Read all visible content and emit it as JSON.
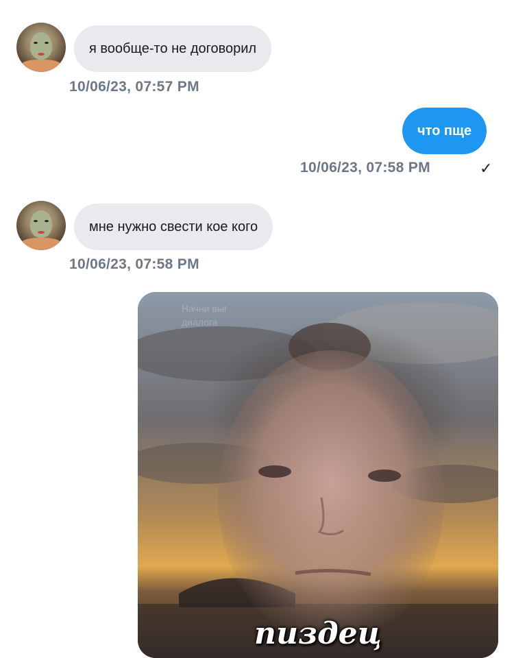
{
  "messages": [
    {
      "text": "я вообще-то не договорил",
      "timestamp": "10/06/23, 07:57 PM"
    },
    {
      "text": "что пще",
      "timestamp": "10/06/23, 07:58 PM",
      "status_icon": "checkmark-icon",
      "status_glyph": "✓"
    },
    {
      "text": "мне нужно свести кое кого",
      "timestamp": "10/06/23, 07:58 PM"
    },
    {
      "image_caption": "пиздец",
      "image_watermark_line1": "Начни выг",
      "image_watermark_line2": "диалога"
    }
  ],
  "colors": {
    "incoming_bubble": "#e9e9ee",
    "outgoing_bubble": "#1e97f2",
    "timestamp": "#6c7787"
  }
}
